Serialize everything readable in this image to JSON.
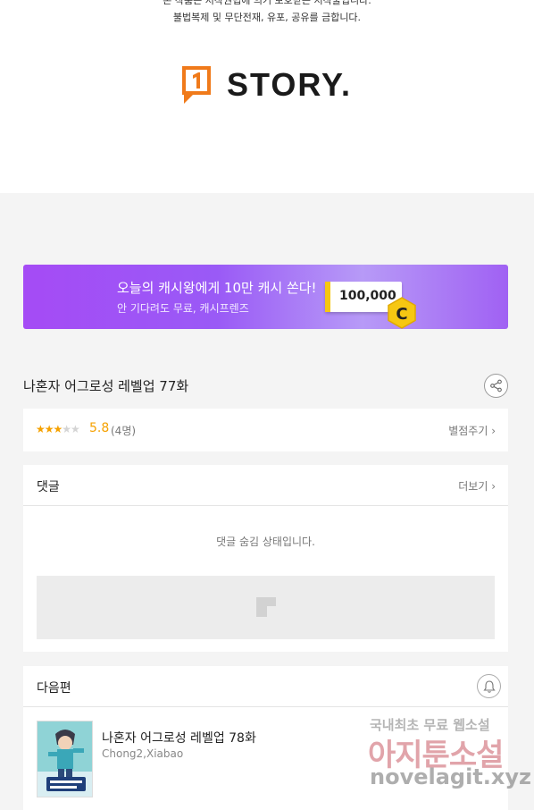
{
  "copyright": {
    "line1": "본 작품은 저작권법에 의거 보호받는 저작물입니다.",
    "line2": "불법복제 및 무단전재, 유포, 공유를 금합니다."
  },
  "logo": {
    "text": "STORY."
  },
  "banner": {
    "title": "오늘의 캐시왕에게 10만 캐시 쏜다!",
    "subtitle": "안 기다려도 무료, 캐시프렌즈",
    "amount": "100,000",
    "coin_letter": "C"
  },
  "episode": {
    "title": "나혼자 어그로성 레벨업 77화"
  },
  "rating": {
    "stars_filled": "★★★",
    "stars_empty": "★★",
    "score": "5.8",
    "count": "(4명)",
    "rate_label": "별점주기 ›"
  },
  "comments": {
    "heading": "댓글",
    "more_label": "더보기 ›",
    "hidden_message": "댓글 숨김 상태입니다."
  },
  "next": {
    "heading": "다음편",
    "title": "나혼자 어그로성 레벨업 78화",
    "author": "Chong2,Xiabao"
  },
  "watermark": {
    "line1": "국내최초 무료 웹소설",
    "line2": "아지툰소설",
    "line3": "novelagit.xyz"
  },
  "colors": {
    "accent_orange": "#f5a100",
    "banner_purple": "#a54bf5",
    "coin_yellow": "#f6c712"
  },
  "icons": [
    "share-icon",
    "bell-icon",
    "star-icon",
    "chevron-right-icon",
    "ad-placeholder-icon"
  ]
}
